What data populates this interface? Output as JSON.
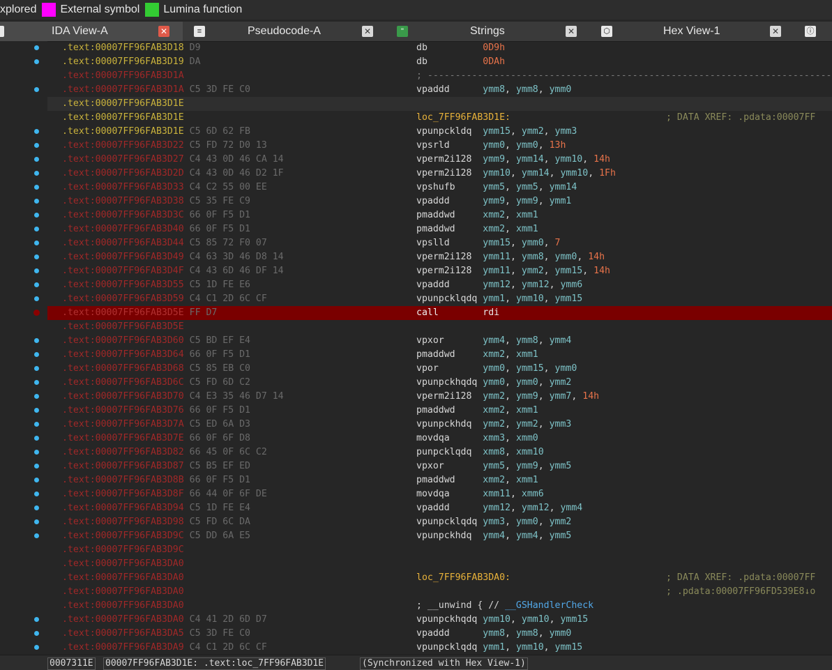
{
  "legend": [
    {
      "label": "xplored",
      "color": null
    },
    {
      "label": "External symbol",
      "color": "#ff00ff"
    },
    {
      "label": "Lumina function",
      "color": "#33cc33"
    }
  ],
  "tabs": [
    {
      "label": "IDA View-A",
      "icon": "disassembly-icon",
      "active": true
    },
    {
      "label": "Pseudocode-A",
      "icon": "pseudocode-icon",
      "active": false
    },
    {
      "label": "Strings",
      "icon": "strings-icon",
      "active": false
    },
    {
      "label": "Hex View-1",
      "icon": "hex-icon",
      "active": false
    }
  ],
  "listing": [
    {
      "addr": ".text:00007FF96FAB3D18",
      "bytes": "D9",
      "addr_color": "yel",
      "mnem": "db",
      "ops": [
        {
          "t": "imm",
          "v": "0D9h"
        }
      ],
      "dot": true
    },
    {
      "addr": ".text:00007FF96FAB3D19",
      "bytes": "DA",
      "addr_color": "yel",
      "mnem": "db",
      "ops": [
        {
          "t": "imm",
          "v": "0DAh"
        }
      ],
      "dot": true
    },
    {
      "addr": ".text:00007FF96FAB3D1A",
      "bytes": "",
      "addr_color": "red",
      "sep": "; ---------------------------------------------------------------------------",
      "dot": false
    },
    {
      "addr": ".text:00007FF96FAB3D1A",
      "bytes": "C5 3D FE C0",
      "addr_color": "red",
      "mnem": "vpaddd",
      "ops": [
        {
          "t": "reg",
          "v": "ymm8"
        },
        {
          "t": "reg",
          "v": "ymm8"
        },
        {
          "t": "reg",
          "v": "ymm0"
        }
      ],
      "dot": true
    },
    {
      "addr": ".text:00007FF96FAB3D1E",
      "bytes": "",
      "addr_color": "yel",
      "hl": true,
      "dot": false
    },
    {
      "addr": ".text:00007FF96FAB3D1E",
      "bytes": "",
      "addr_color": "yel",
      "label": "loc_7FF96FAB3D1E:",
      "comment": "; DATA XREF: .pdata:00007FF",
      "dot": false
    },
    {
      "addr": ".text:00007FF96FAB3D1E",
      "bytes": "C5 6D 62 FB",
      "addr_color": "yel",
      "mnem": "vpunpckldq",
      "ops": [
        {
          "t": "reg",
          "v": "ymm15"
        },
        {
          "t": "reg",
          "v": "ymm2"
        },
        {
          "t": "reg",
          "v": "ymm3"
        }
      ],
      "dot": true
    },
    {
      "addr": ".text:00007FF96FAB3D22",
      "bytes": "C5 FD 72 D0 13",
      "addr_color": "red",
      "mnem": "vpsrld",
      "ops": [
        {
          "t": "reg",
          "v": "ymm0"
        },
        {
          "t": "reg",
          "v": "ymm0"
        },
        {
          "t": "imm",
          "v": "13h"
        }
      ],
      "dot": true
    },
    {
      "addr": ".text:00007FF96FAB3D27",
      "bytes": "C4 43 0D 46 CA 14",
      "addr_color": "red",
      "mnem": "vperm2i128",
      "ops": [
        {
          "t": "reg",
          "v": "ymm9"
        },
        {
          "t": "reg",
          "v": "ymm14"
        },
        {
          "t": "reg",
          "v": "ymm10"
        },
        {
          "t": "imm",
          "v": "14h"
        }
      ],
      "dot": true
    },
    {
      "addr": ".text:00007FF96FAB3D2D",
      "bytes": "C4 43 0D 46 D2 1F",
      "addr_color": "red",
      "mnem": "vperm2i128",
      "ops": [
        {
          "t": "reg",
          "v": "ymm10"
        },
        {
          "t": "reg",
          "v": "ymm14"
        },
        {
          "t": "reg",
          "v": "ymm10"
        },
        {
          "t": "imm",
          "v": "1Fh"
        }
      ],
      "dot": true
    },
    {
      "addr": ".text:00007FF96FAB3D33",
      "bytes": "C4 C2 55 00 EE",
      "addr_color": "red",
      "mnem": "vpshufb",
      "ops": [
        {
          "t": "reg",
          "v": "ymm5"
        },
        {
          "t": "reg",
          "v": "ymm5"
        },
        {
          "t": "reg",
          "v": "ymm14"
        }
      ],
      "dot": true
    },
    {
      "addr": ".text:00007FF96FAB3D38",
      "bytes": "C5 35 FE C9",
      "addr_color": "red",
      "mnem": "vpaddd",
      "ops": [
        {
          "t": "reg",
          "v": "ymm9"
        },
        {
          "t": "reg",
          "v": "ymm9"
        },
        {
          "t": "reg",
          "v": "ymm1"
        }
      ],
      "dot": true
    },
    {
      "addr": ".text:00007FF96FAB3D3C",
      "bytes": "66 0F F5 D1",
      "addr_color": "red",
      "mnem": "pmaddwd",
      "ops": [
        {
          "t": "reg",
          "v": "xmm2"
        },
        {
          "t": "reg",
          "v": "xmm1"
        }
      ],
      "dot": true
    },
    {
      "addr": ".text:00007FF96FAB3D40",
      "bytes": "66 0F F5 D1",
      "addr_color": "red",
      "mnem": "pmaddwd",
      "ops": [
        {
          "t": "reg",
          "v": "xmm2"
        },
        {
          "t": "reg",
          "v": "xmm1"
        }
      ],
      "dot": true
    },
    {
      "addr": ".text:00007FF96FAB3D44",
      "bytes": "C5 85 72 F0 07",
      "addr_color": "red",
      "mnem": "vpslld",
      "ops": [
        {
          "t": "reg",
          "v": "ymm15"
        },
        {
          "t": "reg",
          "v": "ymm0"
        },
        {
          "t": "imm",
          "v": "7"
        }
      ],
      "dot": true
    },
    {
      "addr": ".text:00007FF96FAB3D49",
      "bytes": "C4 63 3D 46 D8 14",
      "addr_color": "red",
      "mnem": "vperm2i128",
      "ops": [
        {
          "t": "reg",
          "v": "ymm11"
        },
        {
          "t": "reg",
          "v": "ymm8"
        },
        {
          "t": "reg",
          "v": "ymm0"
        },
        {
          "t": "imm",
          "v": "14h"
        }
      ],
      "dot": true
    },
    {
      "addr": ".text:00007FF96FAB3D4F",
      "bytes": "C4 43 6D 46 DF 14",
      "addr_color": "red",
      "mnem": "vperm2i128",
      "ops": [
        {
          "t": "reg",
          "v": "ymm11"
        },
        {
          "t": "reg",
          "v": "ymm2"
        },
        {
          "t": "reg",
          "v": "ymm15"
        },
        {
          "t": "imm",
          "v": "14h"
        }
      ],
      "dot": true
    },
    {
      "addr": ".text:00007FF96FAB3D55",
      "bytes": "C5 1D FE E6",
      "addr_color": "red",
      "mnem": "vpaddd",
      "ops": [
        {
          "t": "reg",
          "v": "ymm12"
        },
        {
          "t": "reg",
          "v": "ymm12"
        },
        {
          "t": "reg",
          "v": "ymm6"
        }
      ],
      "dot": true
    },
    {
      "addr": ".text:00007FF96FAB3D59",
      "bytes": "C4 C1 2D 6C CF",
      "addr_color": "red",
      "mnem": "vpunpcklqdq",
      "ops": [
        {
          "t": "reg",
          "v": "ymm1"
        },
        {
          "t": "reg",
          "v": "ymm10"
        },
        {
          "t": "reg",
          "v": "ymm15"
        }
      ],
      "dot": true
    },
    {
      "addr": ".text:00007FF96FAB3D5E",
      "bytes": "FF D7",
      "addr_color": "bpaddr",
      "mnem": "call",
      "ops": [
        {
          "t": "reg",
          "v": "rdi"
        }
      ],
      "bp": true,
      "dot": false
    },
    {
      "addr": ".text:00007FF96FAB3D5E",
      "bytes": "",
      "addr_color": "red",
      "dot": false
    },
    {
      "addr": ".text:00007FF96FAB3D60",
      "bytes": "C5 BD EF E4",
      "addr_color": "red",
      "mnem": "vpxor",
      "ops": [
        {
          "t": "reg",
          "v": "ymm4"
        },
        {
          "t": "reg",
          "v": "ymm8"
        },
        {
          "t": "reg",
          "v": "ymm4"
        }
      ],
      "dot": true
    },
    {
      "addr": ".text:00007FF96FAB3D64",
      "bytes": "66 0F F5 D1",
      "addr_color": "red",
      "mnem": "pmaddwd",
      "ops": [
        {
          "t": "reg",
          "v": "xmm2"
        },
        {
          "t": "reg",
          "v": "xmm1"
        }
      ],
      "dot": true
    },
    {
      "addr": ".text:00007FF96FAB3D68",
      "bytes": "C5 85 EB C0",
      "addr_color": "red",
      "mnem": "vpor",
      "ops": [
        {
          "t": "reg",
          "v": "ymm0"
        },
        {
          "t": "reg",
          "v": "ymm15"
        },
        {
          "t": "reg",
          "v": "ymm0"
        }
      ],
      "dot": true
    },
    {
      "addr": ".text:00007FF96FAB3D6C",
      "bytes": "C5 FD 6D C2",
      "addr_color": "red",
      "mnem": "vpunpckhqdq",
      "ops": [
        {
          "t": "reg",
          "v": "ymm0"
        },
        {
          "t": "reg",
          "v": "ymm0"
        },
        {
          "t": "reg",
          "v": "ymm2"
        }
      ],
      "dot": true
    },
    {
      "addr": ".text:00007FF96FAB3D70",
      "bytes": "C4 E3 35 46 D7 14",
      "addr_color": "red",
      "mnem": "vperm2i128",
      "ops": [
        {
          "t": "reg",
          "v": "ymm2"
        },
        {
          "t": "reg",
          "v": "ymm9"
        },
        {
          "t": "reg",
          "v": "ymm7"
        },
        {
          "t": "imm",
          "v": "14h"
        }
      ],
      "dot": true
    },
    {
      "addr": ".text:00007FF96FAB3D76",
      "bytes": "66 0F F5 D1",
      "addr_color": "red",
      "mnem": "pmaddwd",
      "ops": [
        {
          "t": "reg",
          "v": "xmm2"
        },
        {
          "t": "reg",
          "v": "xmm1"
        }
      ],
      "dot": true
    },
    {
      "addr": ".text:00007FF96FAB3D7A",
      "bytes": "C5 ED 6A D3",
      "addr_color": "red",
      "mnem": "vpunpckhdq",
      "ops": [
        {
          "t": "reg",
          "v": "ymm2"
        },
        {
          "t": "reg",
          "v": "ymm2"
        },
        {
          "t": "reg",
          "v": "ymm3"
        }
      ],
      "dot": true
    },
    {
      "addr": ".text:00007FF96FAB3D7E",
      "bytes": "66 0F 6F D8",
      "addr_color": "red",
      "mnem": "movdqa",
      "ops": [
        {
          "t": "reg",
          "v": "xmm3"
        },
        {
          "t": "reg",
          "v": "xmm0"
        }
      ],
      "dot": true
    },
    {
      "addr": ".text:00007FF96FAB3D82",
      "bytes": "66 45 0F 6C C2",
      "addr_color": "red",
      "mnem": "punpcklqdq",
      "ops": [
        {
          "t": "reg",
          "v": "xmm8"
        },
        {
          "t": "reg",
          "v": "xmm10"
        }
      ],
      "dot": true
    },
    {
      "addr": ".text:00007FF96FAB3D87",
      "bytes": "C5 B5 EF ED",
      "addr_color": "red",
      "mnem": "vpxor",
      "ops": [
        {
          "t": "reg",
          "v": "ymm5"
        },
        {
          "t": "reg",
          "v": "ymm9"
        },
        {
          "t": "reg",
          "v": "ymm5"
        }
      ],
      "dot": true
    },
    {
      "addr": ".text:00007FF96FAB3D8B",
      "bytes": "66 0F F5 D1",
      "addr_color": "red",
      "mnem": "pmaddwd",
      "ops": [
        {
          "t": "reg",
          "v": "xmm2"
        },
        {
          "t": "reg",
          "v": "xmm1"
        }
      ],
      "dot": true
    },
    {
      "addr": ".text:00007FF96FAB3D8F",
      "bytes": "66 44 0F 6F DE",
      "addr_color": "red",
      "mnem": "movdqa",
      "ops": [
        {
          "t": "reg",
          "v": "xmm11"
        },
        {
          "t": "reg",
          "v": "xmm6"
        }
      ],
      "dot": true
    },
    {
      "addr": ".text:00007FF96FAB3D94",
      "bytes": "C5 1D FE E4",
      "addr_color": "red",
      "mnem": "vpaddd",
      "ops": [
        {
          "t": "reg",
          "v": "ymm12"
        },
        {
          "t": "reg",
          "v": "ymm12"
        },
        {
          "t": "reg",
          "v": "ymm4"
        }
      ],
      "dot": true
    },
    {
      "addr": ".text:00007FF96FAB3D98",
      "bytes": "C5 FD 6C DA",
      "addr_color": "red",
      "mnem": "vpunpcklqdq",
      "ops": [
        {
          "t": "reg",
          "v": "ymm3"
        },
        {
          "t": "reg",
          "v": "ymm0"
        },
        {
          "t": "reg",
          "v": "ymm2"
        }
      ],
      "dot": true
    },
    {
      "addr": ".text:00007FF96FAB3D9C",
      "bytes": "C5 DD 6A E5",
      "addr_color": "red",
      "mnem": "vpunpckhdq",
      "ops": [
        {
          "t": "reg",
          "v": "ymm4"
        },
        {
          "t": "reg",
          "v": "ymm4"
        },
        {
          "t": "reg",
          "v": "ymm5"
        }
      ],
      "dot": true
    },
    {
      "addr": ".text:00007FF96FAB3D9C",
      "bytes": "",
      "addr_color": "red",
      "dot": false
    },
    {
      "addr": ".text:00007FF96FAB3DA0",
      "bytes": "",
      "addr_color": "red",
      "dot": false
    },
    {
      "addr": ".text:00007FF96FAB3DA0",
      "bytes": "",
      "addr_color": "red",
      "label": "loc_7FF96FAB3DA0:",
      "comment": "; DATA XREF: .pdata:00007FF",
      "dot": false
    },
    {
      "addr": ".text:00007FF96FAB3DA0",
      "bytes": "",
      "addr_color": "red",
      "comment": "; .pdata:00007FF96FD539E8↓o",
      "dot": false
    },
    {
      "addr": ".text:00007FF96FAB3DA0",
      "bytes": "",
      "addr_color": "red",
      "unwind_prefix": "; __unwind { // ",
      "unwind_handler": "__GSHandlerCheck",
      "dot": false
    },
    {
      "addr": ".text:00007FF96FAB3DA0",
      "bytes": "C4 41 2D 6D D7",
      "addr_color": "red",
      "mnem": "vpunpckhqdq",
      "ops": [
        {
          "t": "reg",
          "v": "ymm10"
        },
        {
          "t": "reg",
          "v": "ymm10"
        },
        {
          "t": "reg",
          "v": "ymm15"
        }
      ],
      "dot": true
    },
    {
      "addr": ".text:00007FF96FAB3DA5",
      "bytes": "C5 3D FE C0",
      "addr_color": "red",
      "mnem": "vpaddd",
      "ops": [
        {
          "t": "reg",
          "v": "ymm8"
        },
        {
          "t": "reg",
          "v": "ymm8"
        },
        {
          "t": "reg",
          "v": "ymm0"
        }
      ],
      "dot": true
    },
    {
      "addr": ".text:00007FF96FAB3DA9",
      "bytes": "C4 C1 2D 6C CF",
      "addr_color": "red",
      "mnem": "vpunpcklqdq",
      "ops": [
        {
          "t": "reg",
          "v": "ymm1"
        },
        {
          "t": "reg",
          "v": "ymm10"
        },
        {
          "t": "reg",
          "v": "ymm15"
        }
      ],
      "dot": true
    }
  ],
  "status": {
    "offset": "0007311E",
    "location": "00007FF96FAB3D1E: .text:loc_7FF96FAB3D1E",
    "sync": "(Synchronized with Hex View-1)"
  }
}
